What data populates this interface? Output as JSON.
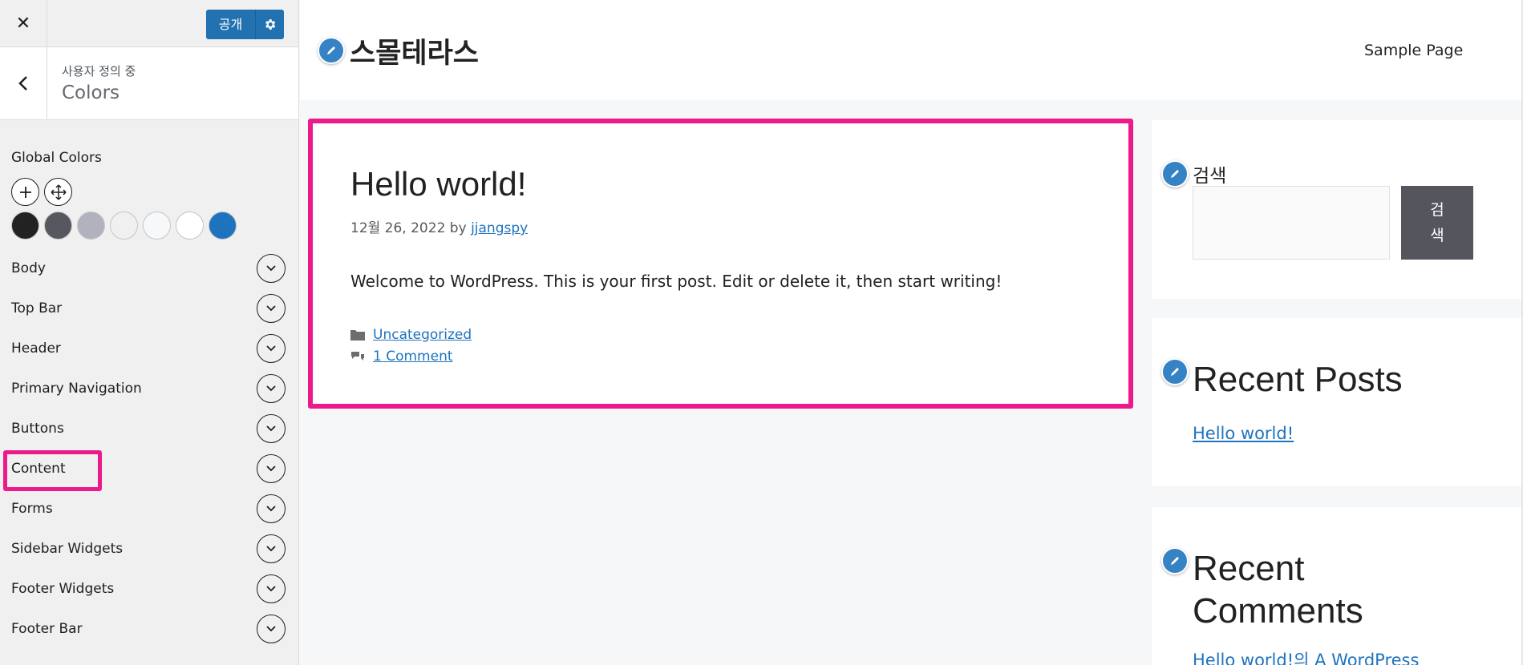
{
  "customizer": {
    "publish_label": "공개",
    "customizing_label": "사용자 정의 중",
    "section_title": "Colors",
    "global_colors_label": "Global Colors",
    "swatches": [
      "#222222",
      "#575760",
      "#b2b2be",
      "#f0f0f0",
      "#f7f8f9",
      "#ffffff",
      "#1e73be"
    ],
    "rows": [
      "Body",
      "Top Bar",
      "Header",
      "Primary Navigation",
      "Buttons",
      "Content",
      "Forms",
      "Sidebar Widgets",
      "Footer Widgets",
      "Footer Bar"
    ],
    "highlight_color": "#ec1a8a"
  },
  "site": {
    "title": "스몰테라스",
    "nav_item": "Sample Page"
  },
  "post": {
    "title": "Hello world!",
    "date": "12월 26, 2022",
    "by": "by",
    "author": "jjangspy",
    "content": "Welcome to WordPress. This is your first post. Edit or delete it, then start writing!",
    "category": "Uncategorized",
    "comments": "1 Comment"
  },
  "widgets": {
    "search_title": "검색",
    "search_button_line1": "검",
    "search_button_line2": "색",
    "recent_posts_title": "Recent Posts",
    "recent_post_link": "Hello world!",
    "recent_comments_title_line1": "Recent",
    "recent_comments_title_line2": "Comments",
    "recent_comment_link": "Hello world!의 A WordPress"
  }
}
